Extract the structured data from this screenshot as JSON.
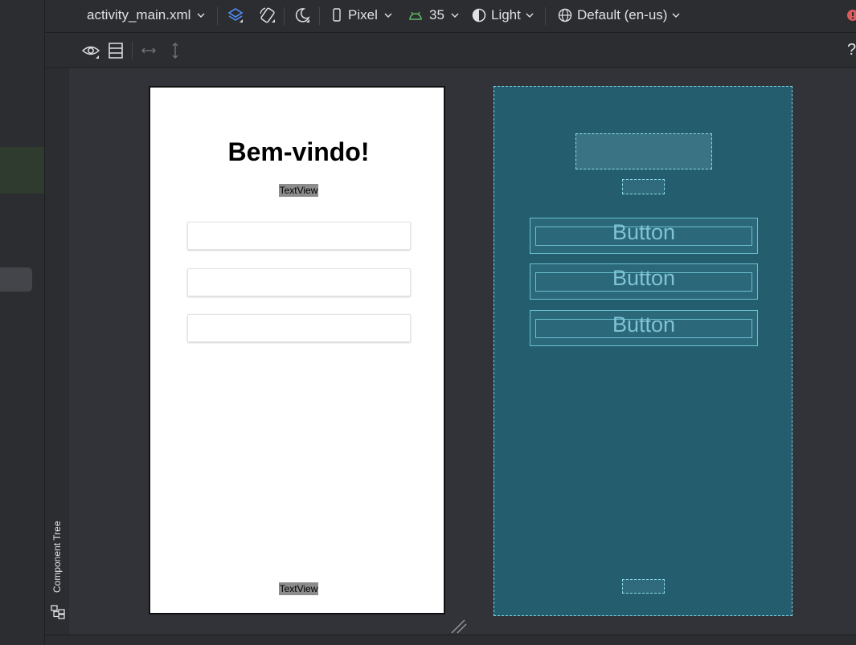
{
  "toolbar": {
    "file_name": "activity_main.xml",
    "device": "Pixel",
    "api_level": "35",
    "theme": "Light",
    "locale": "Default (en-us)",
    "help": "?"
  },
  "side_panel": {
    "component_tree_label": "Component Tree"
  },
  "design_preview": {
    "title": "Bem-vindo!",
    "textview_top": "TextView",
    "textview_bottom": "TextView",
    "edit_fields": [
      "",
      "",
      ""
    ]
  },
  "blueprint_preview": {
    "buttons": [
      "Button",
      "Button",
      "Button"
    ]
  },
  "colors": {
    "ide_background": "#2b2d30",
    "canvas_background": "#313338",
    "blueprint_fill": "#235d6e",
    "blueprint_stroke": "#7fd3e6",
    "api_green": "#5fb865",
    "accent_blue": "#4f8ff7",
    "error_red": "#db5c5c"
  },
  "icons": [
    "layers-icon",
    "rotate-icon",
    "night-mode-icon",
    "device-icon",
    "android-icon",
    "theme-icon",
    "globe-icon",
    "eye-icon",
    "blueprint-icon",
    "horizontal-resize-icon",
    "vertical-resize-icon",
    "component-tree-icon",
    "error-icon",
    "resize-handle-icon"
  ]
}
